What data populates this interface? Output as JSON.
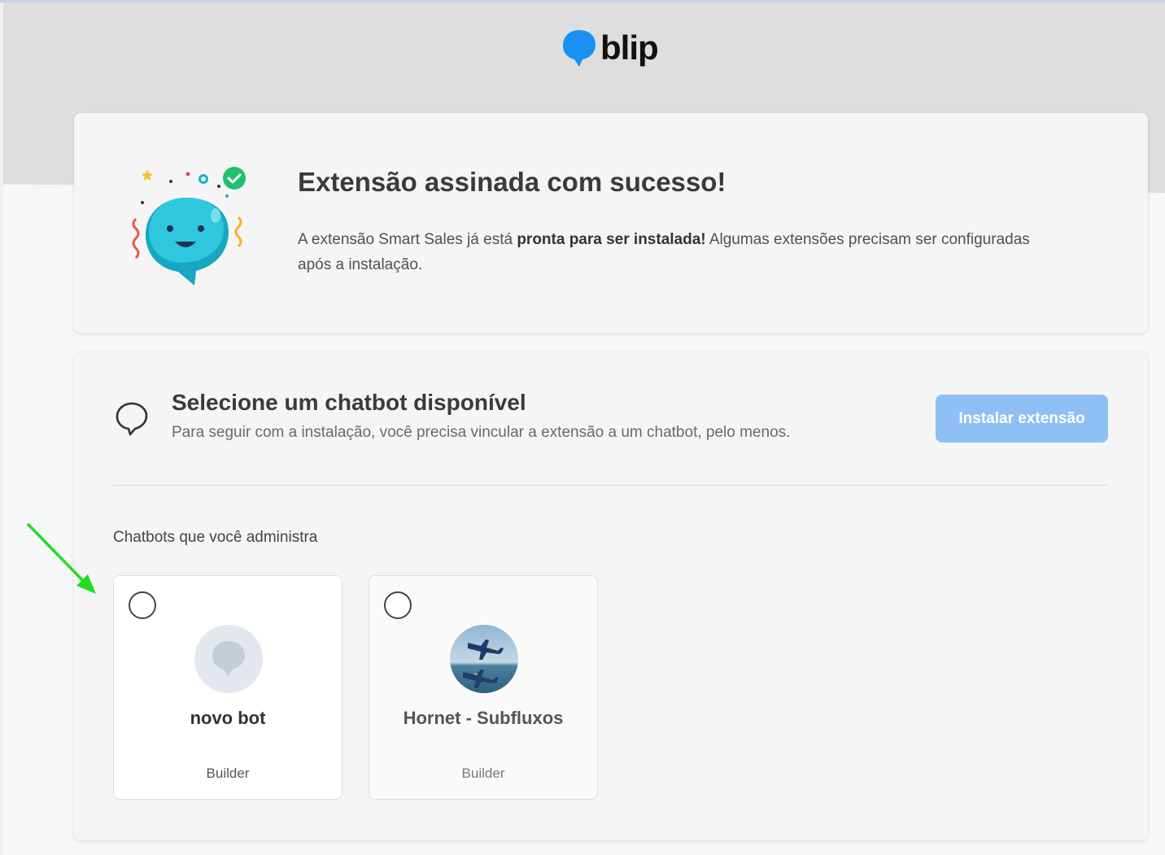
{
  "brand": {
    "logo_text": "blip",
    "accent": "#1a91f0"
  },
  "success": {
    "title": "Extensão assinada com sucesso!",
    "text_before": "A extensão Smart Sales já está ",
    "text_bold": "pronta para ser instalada!",
    "text_after": " Algumas extensões precisam ser configuradas após a instalação."
  },
  "select": {
    "title": "Selecione um chatbot disponível",
    "subtitle": "Para seguir com a instalação, você precisa vincular a extensão a um chatbot, pelo menos.",
    "install_button": "Instalar extensão",
    "install_button_color": "#8fc0f4",
    "bots_label": "Chatbots que você administra"
  },
  "bots": [
    {
      "name": "novo bot",
      "type": "Builder",
      "selected": false
    },
    {
      "name": "Hornet - Subfluxos",
      "type": "Builder",
      "selected": false
    }
  ],
  "annotation_color": "#22dd22"
}
